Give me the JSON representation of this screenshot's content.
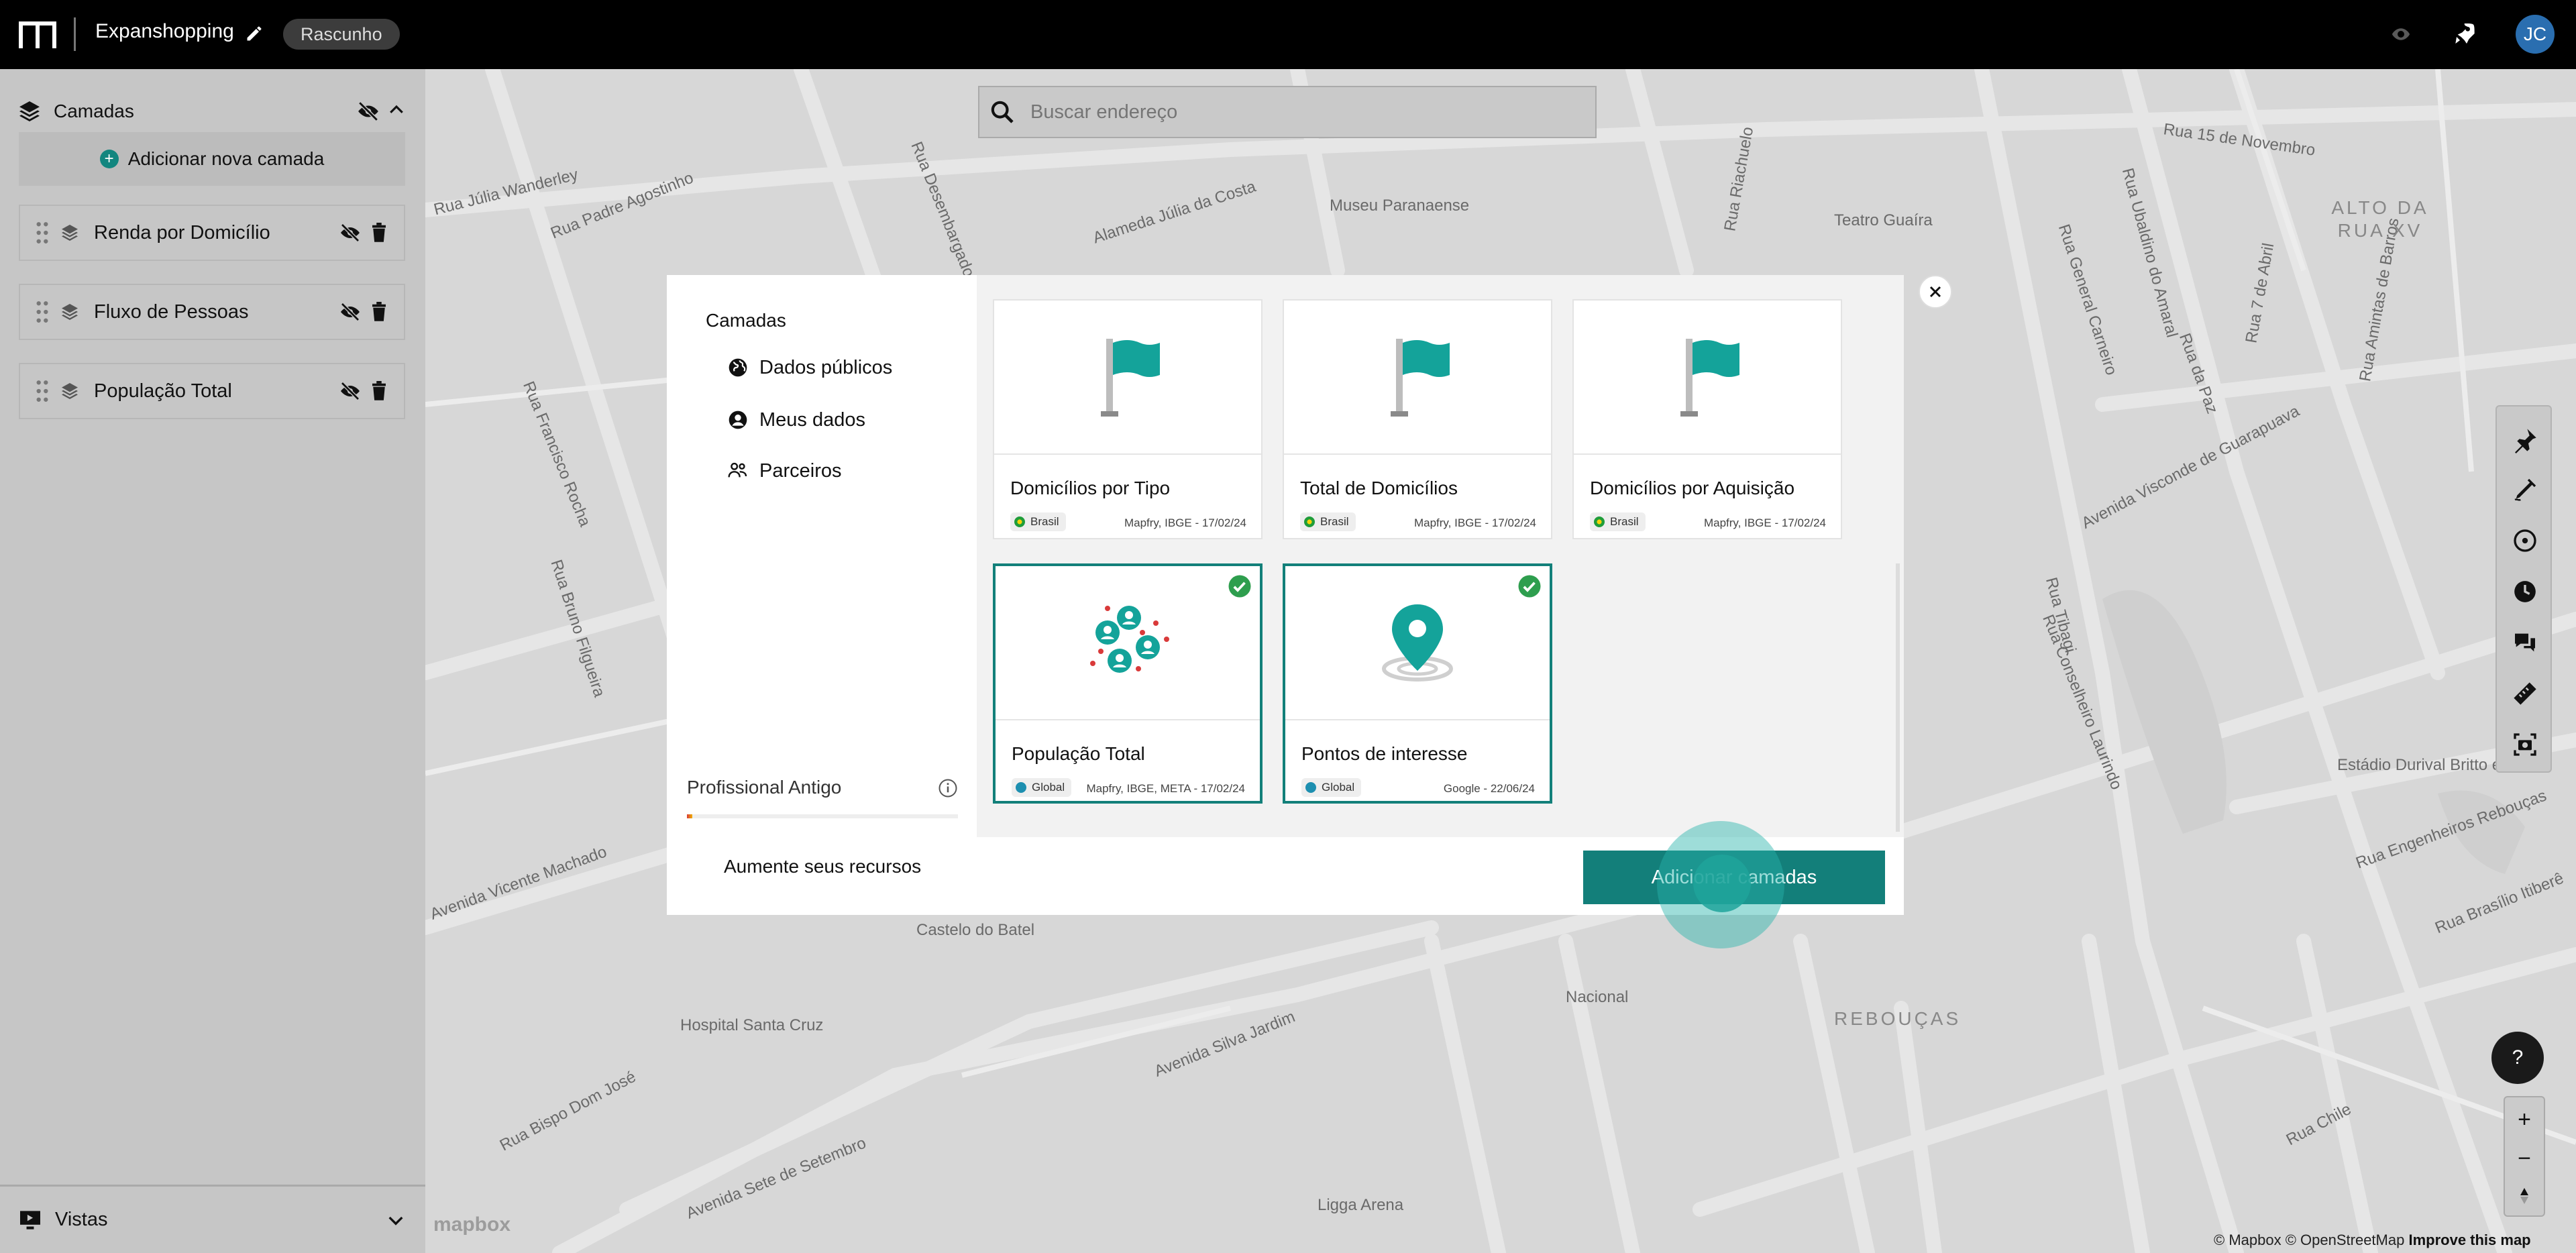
{
  "topbar": {
    "project_title": "Expanshopping",
    "draft_badge": "Rascunho",
    "avatar_initials": "JC"
  },
  "sidebar": {
    "title": "Camadas",
    "add_layer": "Adicionar nova camada",
    "layers": [
      {
        "name": "Renda por Domicílio"
      },
      {
        "name": "Fluxo de Pessoas"
      },
      {
        "name": "População Total"
      }
    ],
    "footer_title": "Vistas"
  },
  "map": {
    "search_placeholder": "Buscar endereço",
    "streets": [
      "Rua Júlia Wanderley",
      "Rua Padre Agostinho",
      "Rua Desembargador Motta",
      "Alameda Júlia da Costa",
      "Museu Paranaense",
      "Rua Riachuelo",
      "Teatro Guaíra",
      "Rua 15 de Novembro",
      "Rua Ubaldino do Amaral",
      "Rua General Carneiro",
      "Rua 7 de Abril",
      "Rua Amintas de Barros",
      "Rua da Paz",
      "Avenida Visconde de Guarapuava",
      "Rua Tibagi",
      "Rua Conselheiro Laurindo",
      "Estádio Durival Britto e Silva",
      "Avenida Vicente Machado",
      "Castelo do Batel",
      "Avenida Silva Jardim",
      "Hospital Santa Cruz",
      "Rua Bispo Dom José",
      "Avenida Sete de Setembro",
      "Nacional",
      "Ligga Arena",
      "Rua Francisco Rocha",
      "Rua Bruno Filgueira",
      "Rua Engenheiros Rebouças",
      "Rua Brasílio Itiberê",
      "Rua Chile"
    ],
    "districts": [
      "ALTO DA RUA XV",
      "REBOUÇAS"
    ],
    "attribution": "© Mapbox © OpenStreetMap",
    "improve": "Improve this map",
    "mapbox_logo": "mapbox",
    "help": "?"
  },
  "modal": {
    "nav_title": "Camadas",
    "nav_items": [
      "Dados públicos",
      "Meus dados",
      "Parceiros"
    ],
    "plan_label": "Profissional Antigo",
    "plan_usage": 0.02,
    "upgrade_link": "Aumente seus recursos",
    "add_button": "Adicionar camadas",
    "cards": [
      {
        "title": "Domicílios por Tipo",
        "tag": "Brasil",
        "source": "Mapfry, IBGE - 17/02/24",
        "selected": false
      },
      {
        "title": "Total de Domicílios",
        "tag": "Brasil",
        "source": "Mapfry, IBGE - 17/02/24",
        "selected": false
      },
      {
        "title": "Domicílios por Aquisição",
        "tag": "Brasil",
        "source": "Mapfry, IBGE - 17/02/24",
        "selected": false
      },
      {
        "title": "População Total",
        "tag": "Global",
        "source": "Mapfry, IBGE, META - 17/02/24",
        "selected": true
      },
      {
        "title": "Pontos de interesse",
        "tag": "Global",
        "source": "Google - 22/06/24",
        "selected": true
      }
    ]
  },
  "colors": {
    "accent": "#137f7a",
    "selected_check": "#2e9e4e",
    "topbar": "#000000"
  }
}
